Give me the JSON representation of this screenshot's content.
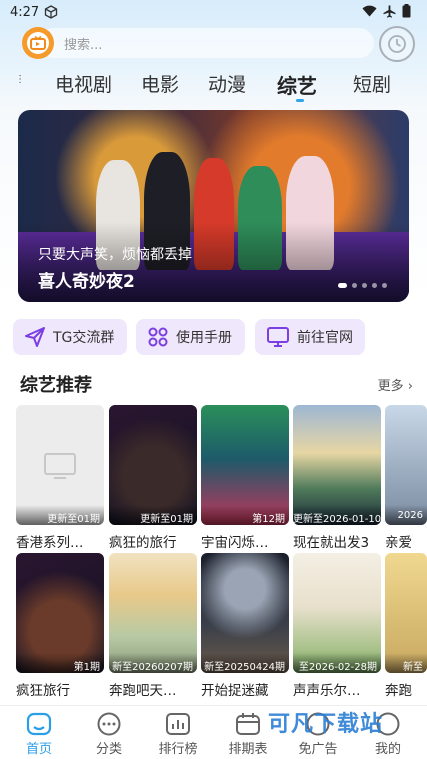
{
  "status": {
    "time": "4:27"
  },
  "search": {
    "placeholder": "搜索..."
  },
  "tabs": [
    {
      "label": "电视剧"
    },
    {
      "label": "电影"
    },
    {
      "label": "动漫"
    },
    {
      "label": "综艺"
    },
    {
      "label": "短剧"
    }
  ],
  "active_tab": "综艺",
  "banner": {
    "subtitle": "只要大声笑，烦恼都丢掉",
    "title": "喜人奇妙夜2",
    "dot_count": 5,
    "active_dot": 1
  },
  "quick_links": [
    {
      "label": "TG交流群",
      "icon": "paper-plane-icon"
    },
    {
      "label": "使用手册",
      "icon": "grid-circles-icon"
    },
    {
      "label": "前往官网",
      "icon": "monitor-icon"
    }
  ],
  "section": {
    "title": "综艺推荐",
    "more": "更多"
  },
  "row1": [
    {
      "title": "香港系列…",
      "badge": "更新至01期"
    },
    {
      "title": "疯狂的旅行",
      "badge": "更新至01期"
    },
    {
      "title": "宇宙闪烁…",
      "badge": "第12期"
    },
    {
      "title": "现在就出发3",
      "badge": "更新至2026-01-10期"
    },
    {
      "title": "亲爱",
      "badge": "2026"
    }
  ],
  "row2": [
    {
      "title": "疯狂旅行",
      "badge": "第1期"
    },
    {
      "title": "奔跑吧天…",
      "badge": "新至20260207期"
    },
    {
      "title": "开始捉迷藏",
      "badge": "新至20250424期"
    },
    {
      "title": "声声乐尔…",
      "badge": "至2026-02-28期"
    },
    {
      "title": "奔跑",
      "badge": "新至"
    }
  ],
  "bottom_nav": [
    {
      "label": "首页",
      "icon": "home-icon"
    },
    {
      "label": "分类",
      "icon": "category-icon"
    },
    {
      "label": "排行榜",
      "icon": "ranking-icon"
    },
    {
      "label": "排期表",
      "icon": "schedule-icon"
    },
    {
      "label": "免广告",
      "icon": "no-ads-icon"
    },
    {
      "label": "我的",
      "icon": "profile-icon"
    }
  ],
  "watermark": "可凡下载站",
  "colors": {
    "accent": "#2b9ee8",
    "quick_bg": "#efe7fb",
    "quick_icon": "#7b3fe4"
  }
}
